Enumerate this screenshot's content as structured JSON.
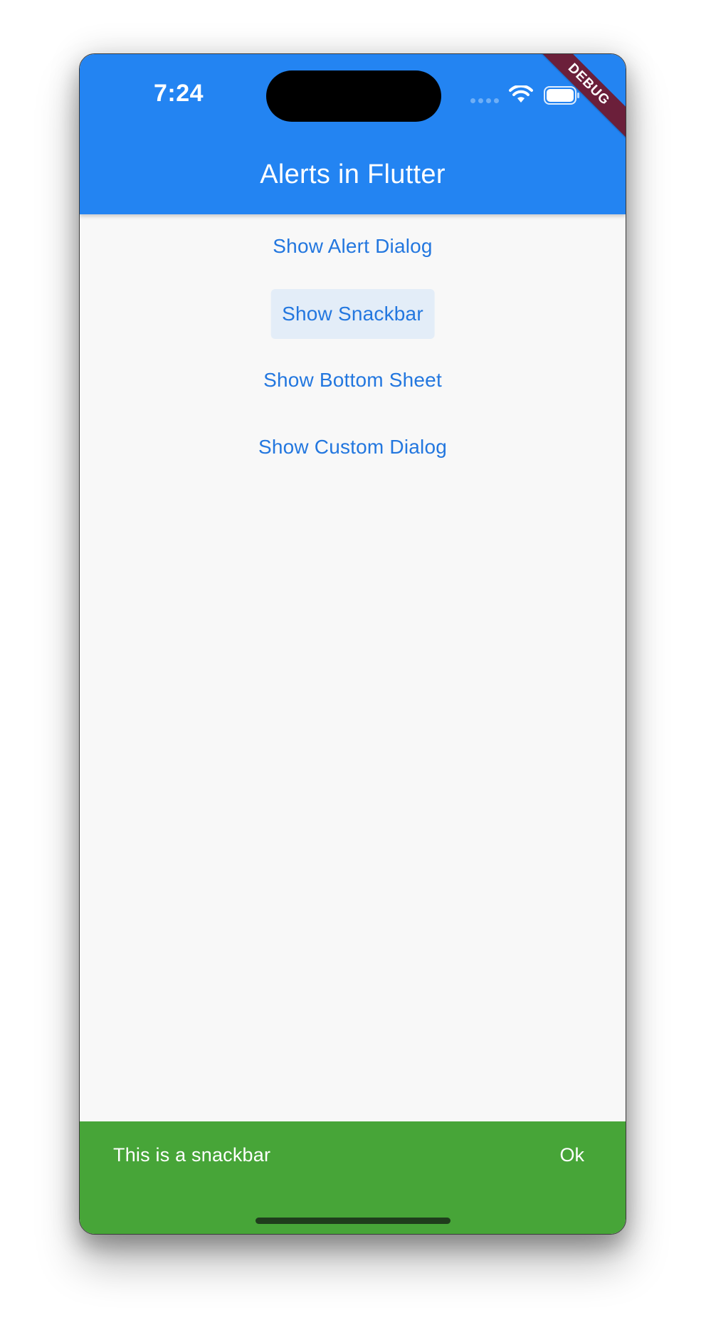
{
  "status_bar": {
    "time": "7:24"
  },
  "app_bar": {
    "title": "Alerts in Flutter",
    "background_color": "#2384f2"
  },
  "debug_banner": {
    "label": "DEBUG",
    "color": "#6b1f3a"
  },
  "buttons": [
    {
      "label": "Show Alert Dialog"
    },
    {
      "label": "Show Snackbar"
    },
    {
      "label": "Show Bottom Sheet"
    },
    {
      "label": "Show Custom Dialog"
    }
  ],
  "snackbar": {
    "message": "This is a snackbar",
    "action_label": "Ok",
    "background_color": "#47a538"
  },
  "icons": {
    "signal": "cellular-signal-icon",
    "wifi": "wifi-icon",
    "battery": "battery-icon"
  }
}
